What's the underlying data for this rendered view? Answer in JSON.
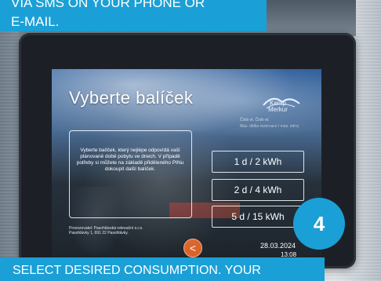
{
  "overlay": {
    "top_banner": {
      "line1": "VIA SMS ON YOUR PHONE OR",
      "line2": "E-MAIL."
    },
    "bottom_banner": "SELECT DESIRED CONSUMPTION. YOUR",
    "step_number": "4"
  },
  "kiosk": {
    "title": "Vyberte balíček",
    "logo_text": {
      "line1": "Kemp",
      "line2": "Merkur"
    },
    "header_small": "Číslo el.                                      Číslo el.",
    "header_row": "Max. délka rezervace / max. zdroj",
    "info_text": "Vyberte balíček, který nejlépe odpovídá vaší plánované době pobytu ve dnech. V případě potřeby si můžete na základě přiděleného PINu dokoupit další balíček.",
    "packages": [
      "1 d / 2 kWh",
      "2 d / 4 kWh",
      "5 d / 15 kWh"
    ],
    "provider_text": "Provozovatel: Pasohlávská rekreační s.r.o. Pasohlávky 1, 691 22 Pasohlávky.",
    "back_symbol": "<",
    "date": "28.03.2024",
    "time": "13:08"
  },
  "colors": {
    "banner": "#1aa0d6",
    "back_button": "#d9642a"
  }
}
